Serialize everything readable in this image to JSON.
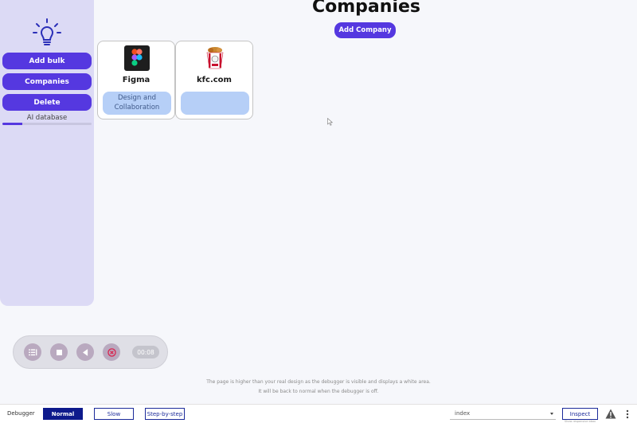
{
  "sidebar": {
    "icon": "lightbulb-icon",
    "buttons": {
      "add_bulk": "Add bulk",
      "companies": "Companies",
      "delete": "Delete"
    },
    "db_label": "AI database",
    "db_progress": 0.22
  },
  "header": {
    "title": "Companies",
    "add_company": "Add Company"
  },
  "companies": [
    {
      "name": "Figma",
      "logo": "figma-logo-icon",
      "category": "Design and Collaboration"
    },
    {
      "name": "kfc.com",
      "logo": "kfc-bucket-logo-icon",
      "category": ""
    }
  ],
  "recorder": {
    "icons": [
      "menu-list-icon",
      "stop-icon",
      "play-back-icon",
      "cancel-icon"
    ],
    "time": "00:08"
  },
  "debug_notice": {
    "line1": "The page is higher than your real design as the debugger is visible and displays a white area.",
    "line2": "It will be back to normal when the debugger is off."
  },
  "debugger": {
    "label": "Debugger",
    "modes": [
      "Normal",
      "Slow",
      "Step-by-step"
    ],
    "active_mode": "Normal",
    "page_select": "index",
    "inspect": "Inspect",
    "inspect_sub": "Show responsive bbox",
    "colors": {
      "accent": "#5538e0",
      "debug_active": "#0e1a8c"
    }
  }
}
